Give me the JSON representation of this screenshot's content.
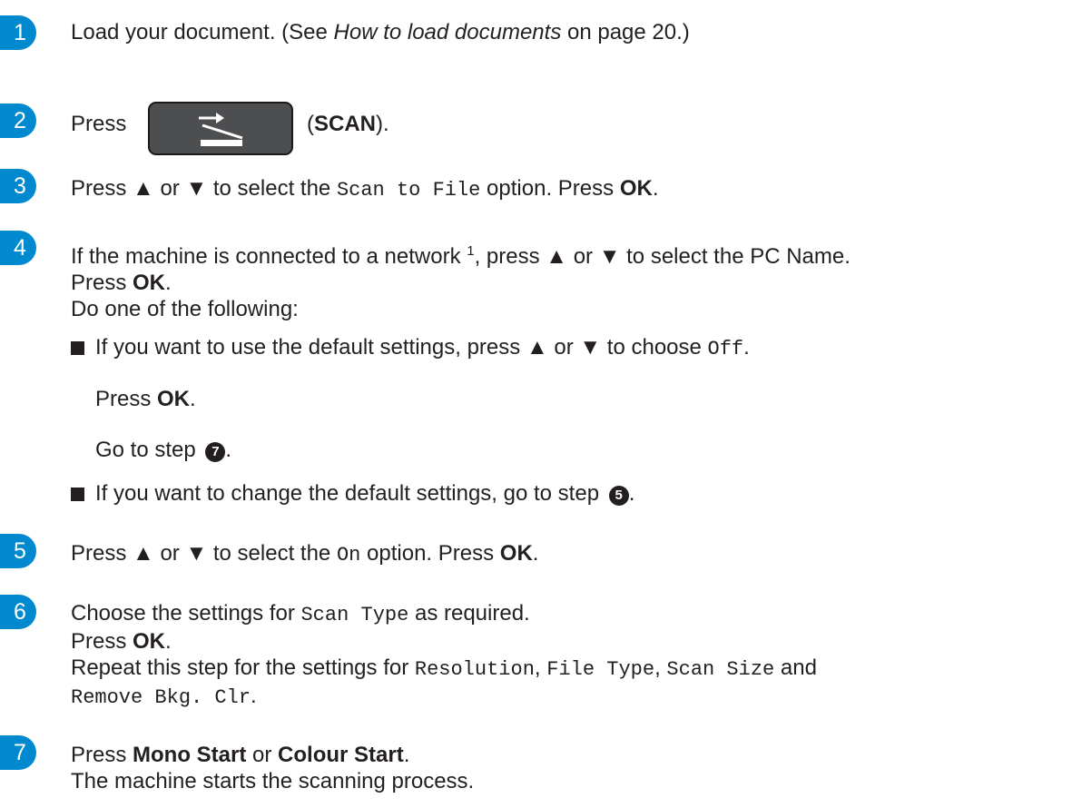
{
  "steps": [
    {
      "number": "1",
      "text_a": "Load your document. (See ",
      "link_text": "How to load documents",
      "text_b": " on page 20.)"
    },
    {
      "number": "2",
      "press_label": "Press",
      "button_icon": "scan-icon",
      "paren_open": "(",
      "button_label": "SCAN",
      "paren_close": ")."
    },
    {
      "number": "3",
      "text_a": "Press ▲ or ▼ to select the ",
      "code": "Scan to File",
      "text_b": " option. Press ",
      "key": "OK",
      "end": "."
    },
    {
      "number": "4",
      "text_a": "If the machine is connected to a network ",
      "footnote": "1",
      "text_b": ", press ▲ or ▼ to select the PC Name.",
      "line2_a": "Press ",
      "line2_key": "OK",
      "line2_end": ".",
      "line3": "Do one of the following:",
      "bullet1": {
        "text": "If you want to use the default settings, press ▲ or ▼ to choose ",
        "code": "Off",
        "end": ".",
        "sub1_a": "Press ",
        "sub1_key": "OK",
        "sub1_end": ".",
        "sub2_a": "Go to step ",
        "sub2_ref": "7",
        "sub2_end": "."
      },
      "bullet2": {
        "text": "If you want to change the default settings, go to step ",
        "ref": "5",
        "end": "."
      }
    },
    {
      "number": "5",
      "text_a": "Press ▲ or ▼ to select the ",
      "code": "On",
      "text_b": " option. Press ",
      "key": "OK",
      "end": "."
    },
    {
      "number": "6",
      "text_a": "Choose the settings for ",
      "code": "Scan Type",
      "text_b": " as required.",
      "line2_a": "Press ",
      "line2_key": "OK",
      "line2_end": ".",
      "line3_a": "Repeat this step for the settings for ",
      "code_res": "Resolution",
      "comma1": ", ",
      "code_ft": "File Type",
      "comma2": ", ",
      "code_ss": "Scan Size",
      "and": " and",
      "code_rb": "Remove Bkg. Clr",
      "line3_end": "."
    },
    {
      "number": "7",
      "text_a": "Press ",
      "key1": "Mono Start",
      "or": " or ",
      "key2": "Colour Start",
      "end": ".",
      "line2": "The machine starts the scanning process."
    }
  ],
  "colors": {
    "step_badge": "#0089cf",
    "button_bg": "#4d4e50",
    "text": "#231f20"
  }
}
